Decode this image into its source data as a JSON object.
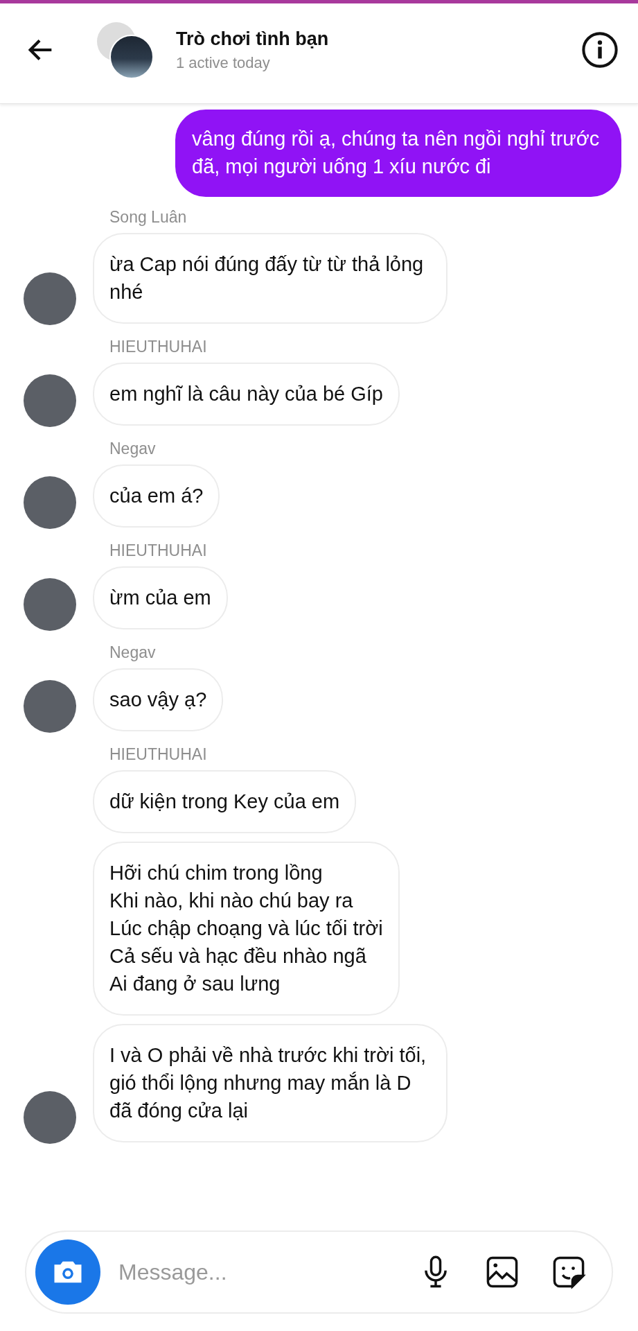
{
  "header": {
    "title": "Trò chơi tình bạn",
    "status": "1 active today"
  },
  "messages": [
    {
      "kind": "outgoing",
      "text": "vâng đúng rồi ạ, chúng ta nên ngồi nghỉ trước đã, mọi người uống 1 xíu nước đi"
    },
    {
      "kind": "incoming",
      "sender": "Song Luân",
      "bubbles": [
        "ừa Cap nói đúng đấy từ từ thả lỏng nhé"
      ]
    },
    {
      "kind": "incoming",
      "sender": "HIEUTHUHAI",
      "bubbles": [
        "em nghĩ là câu này của bé Gíp"
      ]
    },
    {
      "kind": "incoming",
      "sender": "Negav",
      "bubbles": [
        "của em á?"
      ]
    },
    {
      "kind": "incoming",
      "sender": "HIEUTHUHAI",
      "bubbles": [
        "ừm của em"
      ]
    },
    {
      "kind": "incoming",
      "sender": "Negav",
      "bubbles": [
        "sao vậy ạ?"
      ]
    },
    {
      "kind": "incoming",
      "sender": "HIEUTHUHAI",
      "bubbles": [
        "dữ kiện trong Key của em",
        "Hỡi chú chim trong lồng\nKhi nào, khi nào chú bay ra\nLúc chập choạng và lúc tối trời\nCả sếu và hạc đều nhào ngã\nAi đang ở sau lưng",
        "I và O phải về nhà trước khi trời tối, gió thổi lộng nhưng may mắn là D đã đóng cửa lại"
      ]
    }
  ],
  "composer": {
    "placeholder": "Message..."
  }
}
